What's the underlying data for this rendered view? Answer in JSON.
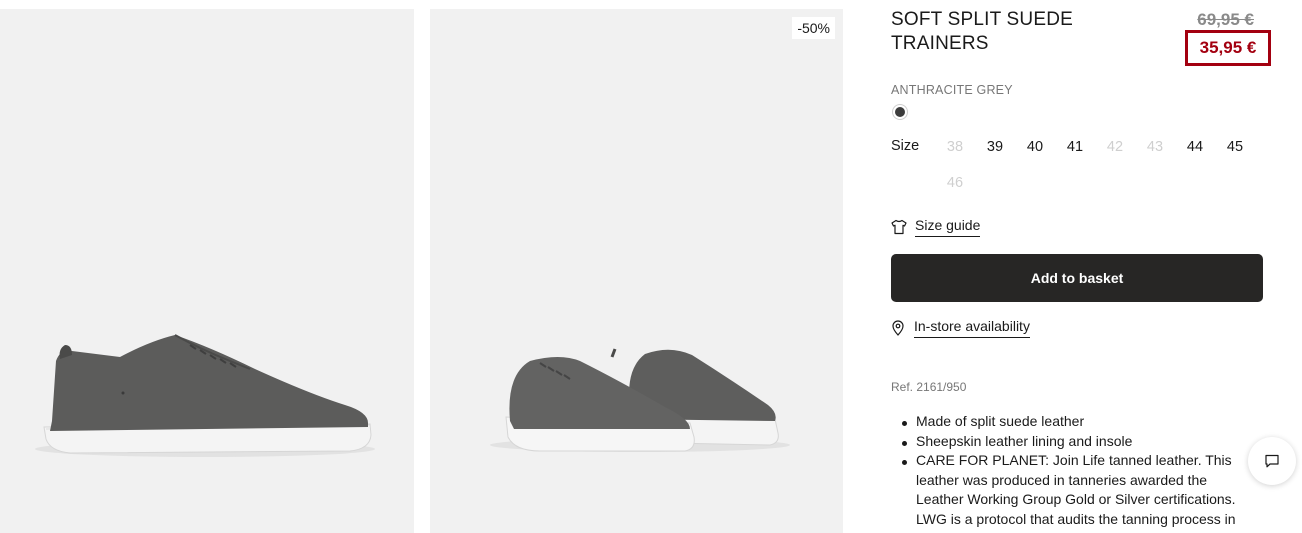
{
  "gallery": {
    "images": [
      {
        "description_icon": "sneaker-side-photo"
      },
      {
        "description_icon": "sneaker-pair-photo"
      }
    ],
    "badge": "-50%"
  },
  "product": {
    "title": "SOFT SPLIT SUEDE TRAINERS",
    "old_price": "69,95 €",
    "new_price": "35,95 €",
    "color_name": "ANTHRACITE GREY",
    "swatch_color": "#3c3c3c",
    "size_label": "Size",
    "sizes": [
      {
        "label": "38",
        "available": false
      },
      {
        "label": "39",
        "available": true
      },
      {
        "label": "40",
        "available": true
      },
      {
        "label": "41",
        "available": true
      },
      {
        "label": "42",
        "available": false
      },
      {
        "label": "43",
        "available": false
      },
      {
        "label": "44",
        "available": true
      },
      {
        "label": "45",
        "available": true
      },
      {
        "label": "46",
        "available": false
      }
    ],
    "size_guide_label": "Size guide",
    "add_to_basket_label": "Add to basket",
    "store_availability_label": "In-store availability",
    "ref": "Ref. 2161/950",
    "features": [
      "Made of split suede leather",
      "Sheepskin leather lining and insole",
      "CARE FOR PLANET: Join Life tanned leather. This leather was produced in tanneries awarded the Leather Working Group Gold or Silver certifications. LWG is a protocol that audits the tanning process in"
    ]
  },
  "colors": {
    "sale_red": "#a30010",
    "button_dark": "#272625",
    "image_bg": "#f1f1f1"
  },
  "chat": {
    "icon": "chat-icon"
  }
}
